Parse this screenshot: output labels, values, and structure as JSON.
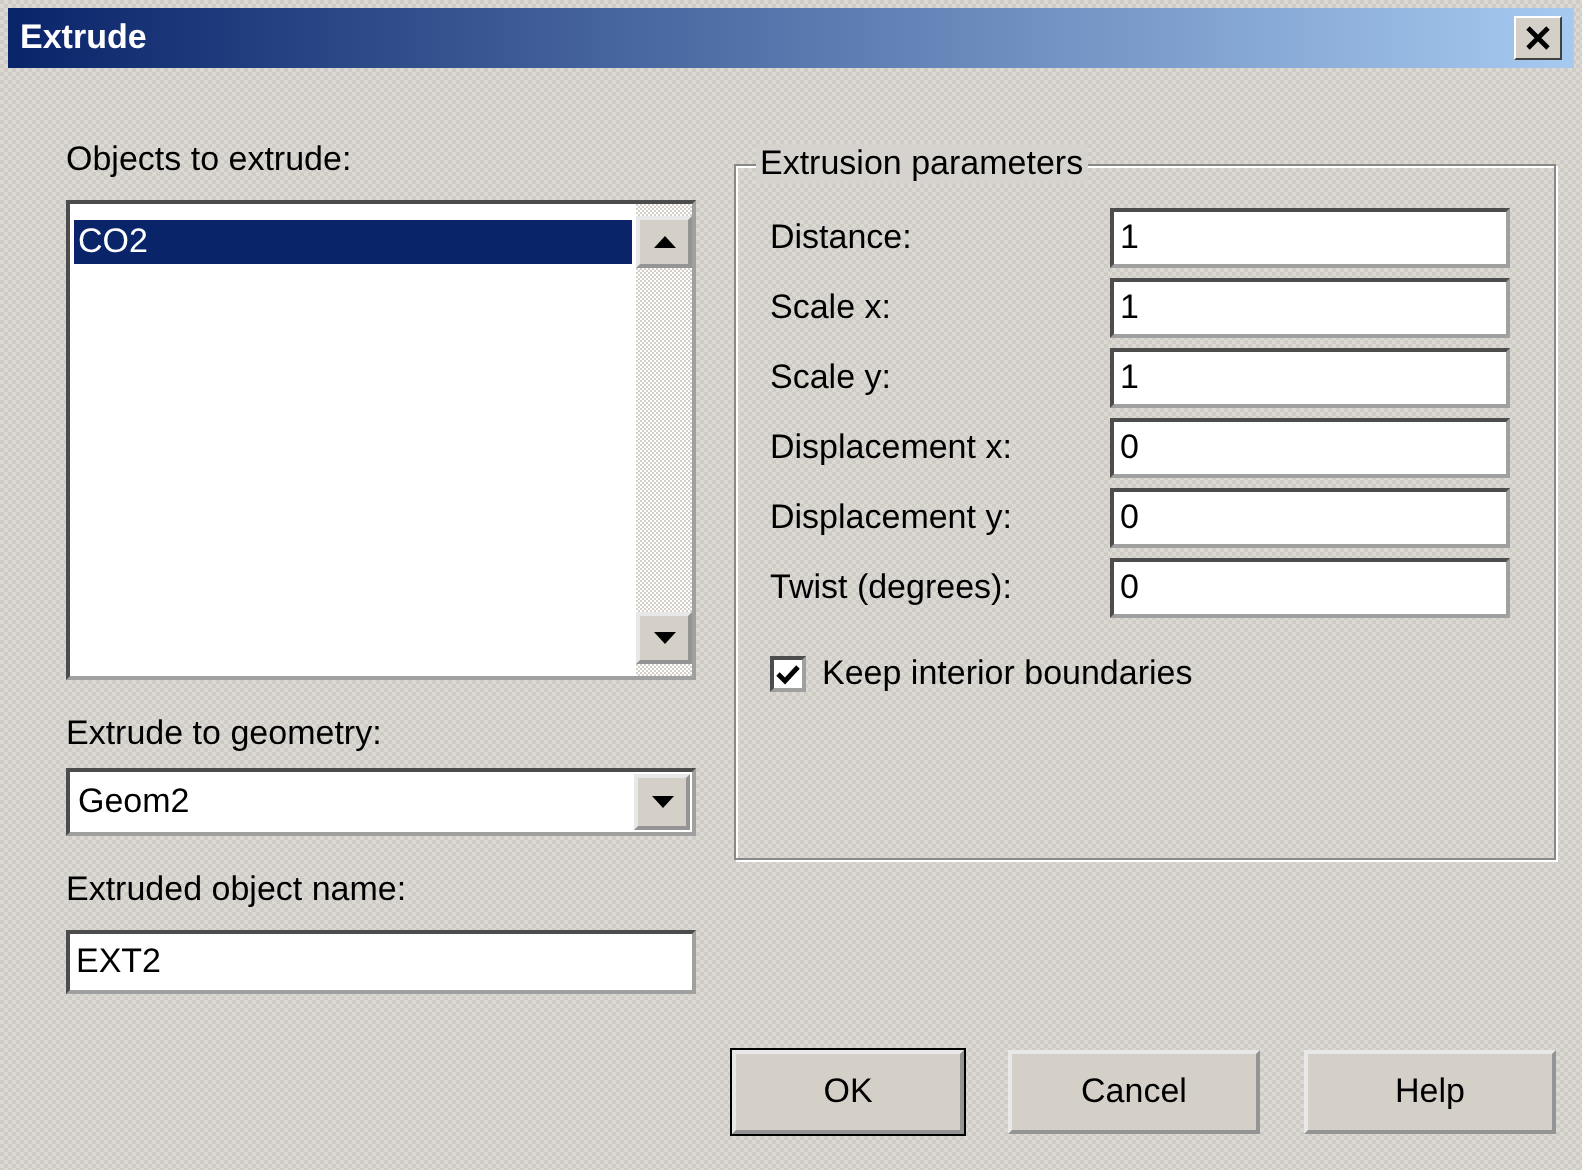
{
  "window": {
    "title": "Extrude"
  },
  "objects": {
    "label": "Objects to extrude:",
    "items": [
      {
        "label": "CO2",
        "selected": true
      }
    ]
  },
  "geometry": {
    "label": "Extrude to geometry:",
    "value": "Geom2"
  },
  "object_name": {
    "label": "Extruded object name:",
    "value": "EXT2"
  },
  "parameters": {
    "title": "Extrusion parameters",
    "fields": [
      {
        "label": "Distance:",
        "value": "1"
      },
      {
        "label": "Scale x:",
        "value": "1"
      },
      {
        "label": "Scale y:",
        "value": "1"
      },
      {
        "label": "Displacement x:",
        "value": "0"
      },
      {
        "label": "Displacement y:",
        "value": "0"
      },
      {
        "label": "Twist (degrees):",
        "value": "0"
      }
    ],
    "checkbox": {
      "label": "Keep interior boundaries",
      "checked": true
    }
  },
  "buttons": [
    {
      "label": "OK"
    },
    {
      "label": "Cancel"
    },
    {
      "label": "Help"
    }
  ]
}
